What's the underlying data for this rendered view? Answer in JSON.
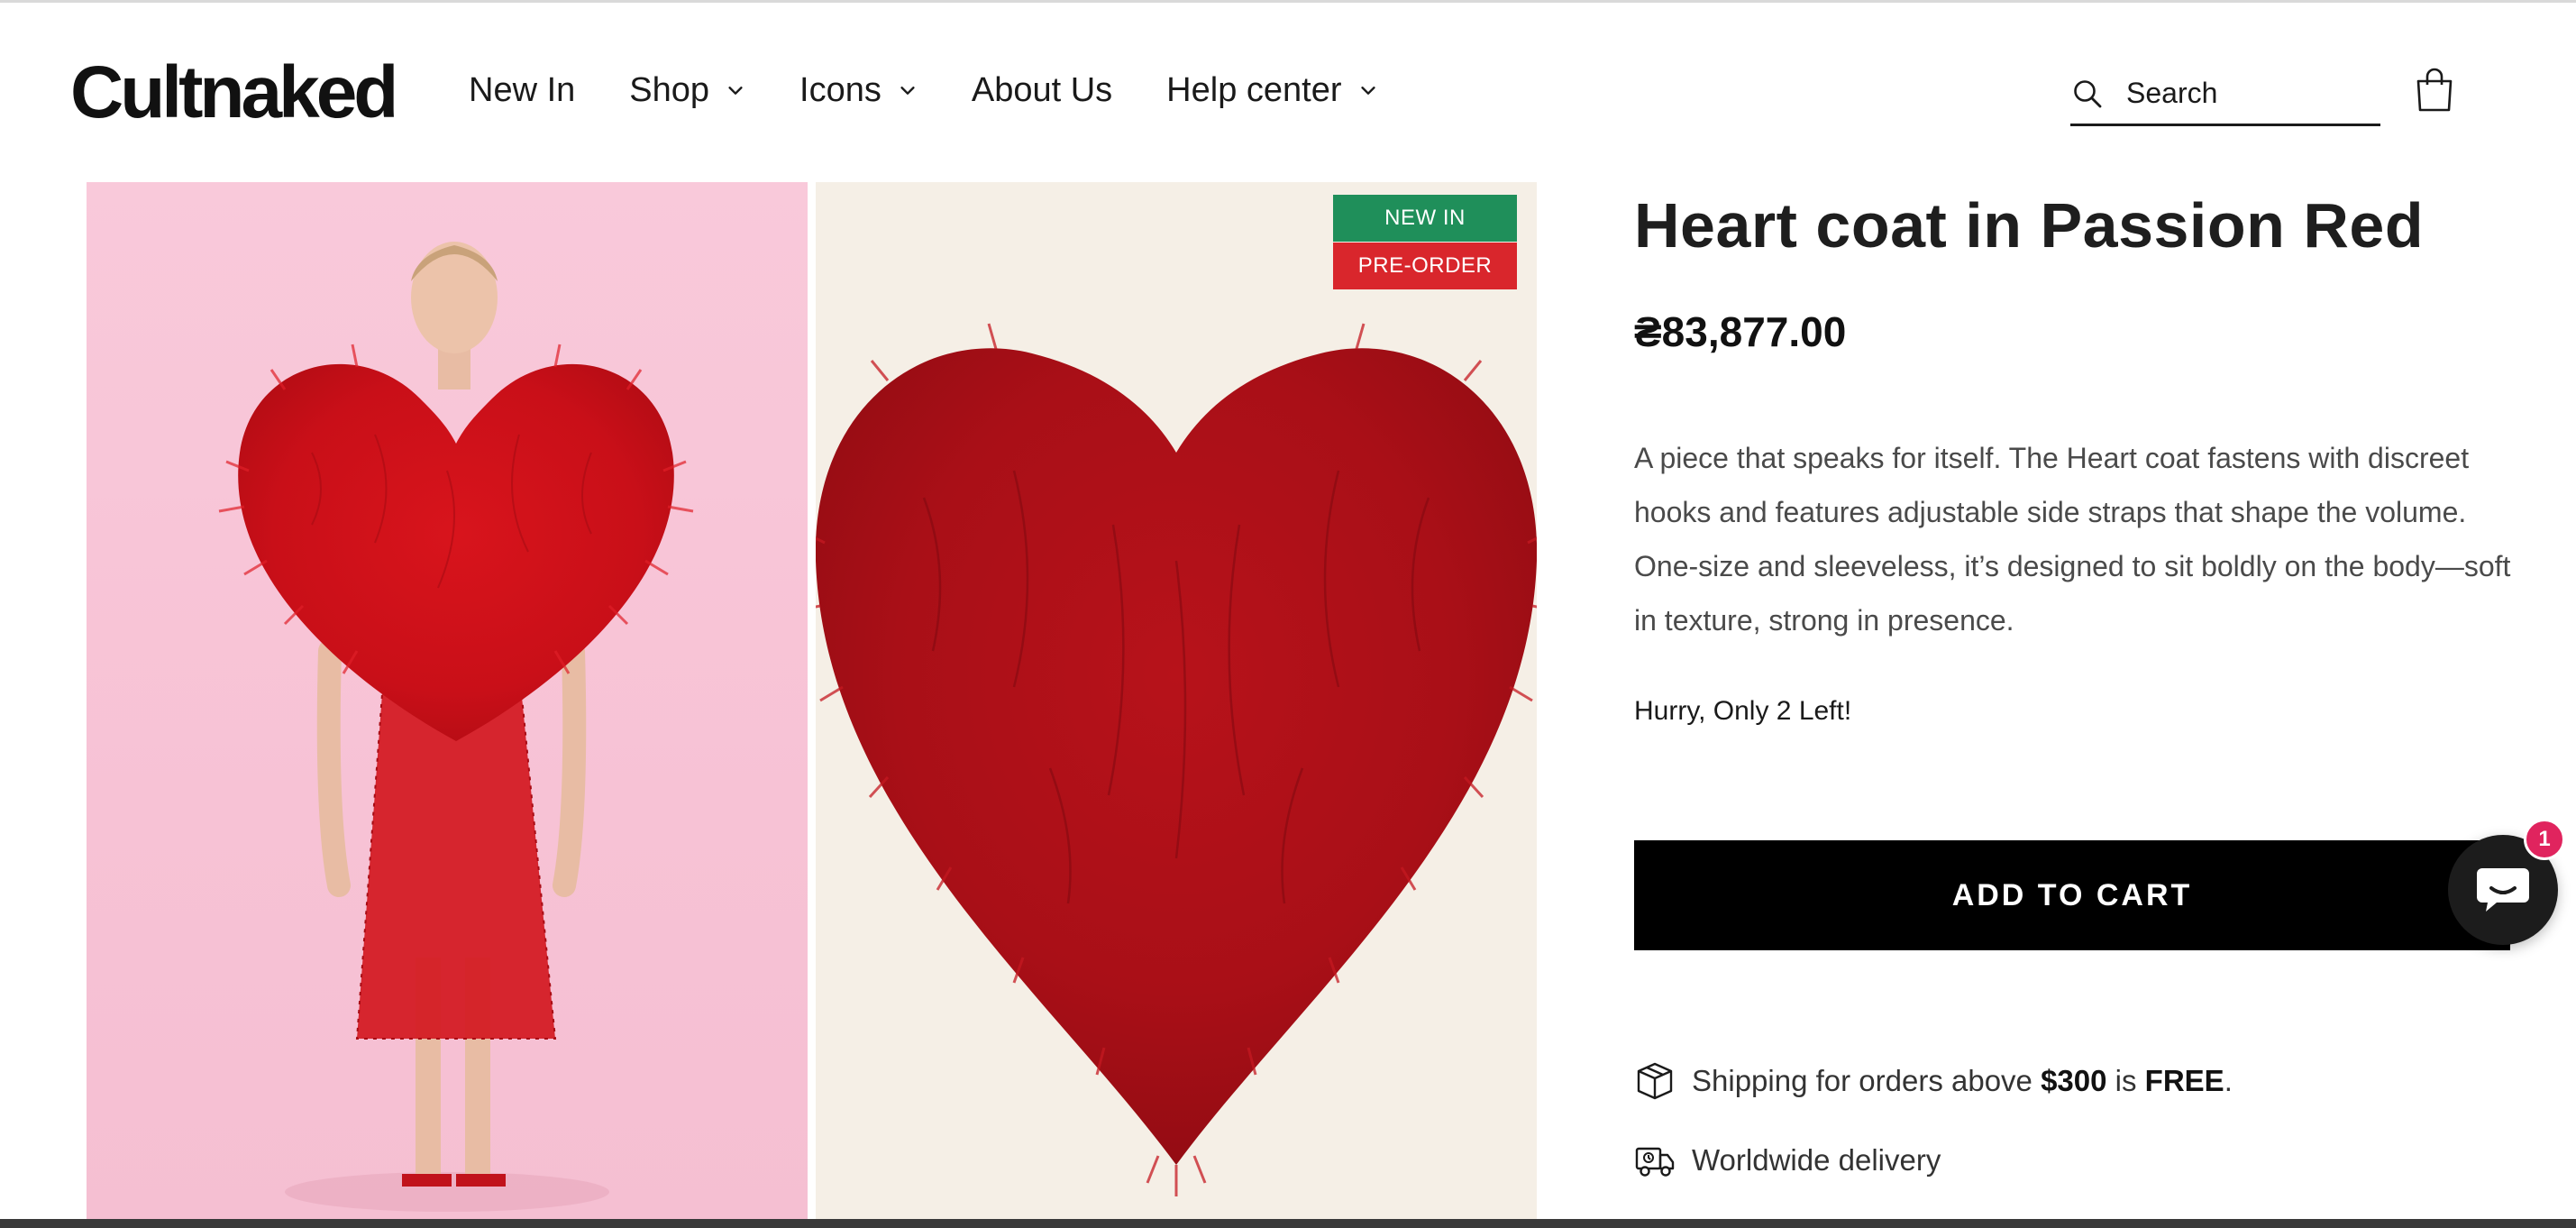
{
  "brand": {
    "logo_text": "Cultnaked"
  },
  "nav": {
    "items": [
      {
        "label": "New In",
        "has_dropdown": false
      },
      {
        "label": "Shop",
        "has_dropdown": true
      },
      {
        "label": "Icons",
        "has_dropdown": true
      },
      {
        "label": "About Us",
        "has_dropdown": false
      },
      {
        "label": "Help center",
        "has_dropdown": true
      }
    ]
  },
  "search": {
    "placeholder": "Search"
  },
  "cart": {
    "icon": "shopping-bag-icon"
  },
  "gallery": {
    "badges": {
      "new_in": "NEW IN",
      "pre_order": "PRE-ORDER"
    },
    "badge_colors": {
      "new_in": "#1f8f5a",
      "pre_order": "#d9262c"
    }
  },
  "product": {
    "title": "Heart coat in Passion Red",
    "price": "₴83,877.00",
    "description": "A piece that speaks for itself. The Heart coat fastens with discreet hooks and features adjustable side straps that shape the volume. One-size and sleeveless, it’s designed to sit boldly on the body—soft in texture, strong in presence.",
    "stock_message": "Hurry, Only 2 Left!",
    "add_to_cart_label": "ADD TO CART"
  },
  "perks": {
    "shipping": {
      "prefix": "Shipping for orders above ",
      "amount": "$300",
      "middle": " is ",
      "free": "FREE",
      "suffix": "."
    },
    "delivery": {
      "label": "Worldwide delivery"
    }
  },
  "chat": {
    "unread_count": "1"
  }
}
